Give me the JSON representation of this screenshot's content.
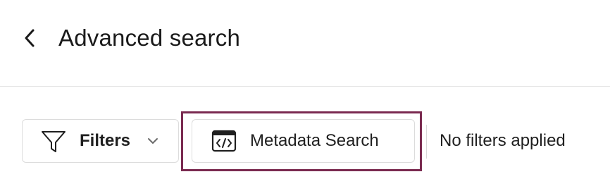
{
  "header": {
    "title": "Advanced search",
    "back_icon": "chevron-left-icon"
  },
  "toolbar": {
    "filters_label": "Filters",
    "filters_icon": "funnel-icon",
    "filters_dropdown_icon": "chevron-down-icon",
    "metadata_search_label": "Metadata Search",
    "metadata_search_icon": "code-window-icon",
    "status_text": "No filters applied",
    "highlight_color": "#7a2a50"
  }
}
